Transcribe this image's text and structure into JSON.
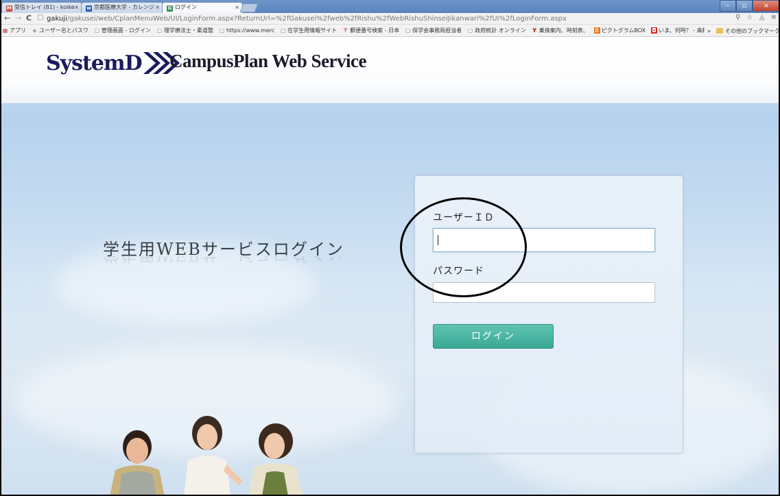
{
  "browser": {
    "tabs": [
      {
        "label": "受信トレイ (81) - koike",
        "favicon": "M",
        "favicon_color": "#d44638"
      },
      {
        "label": "京都医療大学 - カレンジ",
        "favicon": "w",
        "favicon_color": "#2a5db0"
      },
      {
        "label": "ログイン",
        "favicon": "G",
        "favicon_color": "#3b8f5e"
      }
    ],
    "window_buttons": [
      "–",
      "▫",
      "×"
    ],
    "nav": {
      "back": "←",
      "forward": "→",
      "reload": "C"
    },
    "url_host": "gakuji",
    "url_rest": "/gakusei/web/CplanMenuWeb/UI/LoginForm.aspx?ReturnUrl=%2fGakusei%2fweb%2fRishu%2fWebRishuShinseiJikanwari%2fUI%2fLoginForm.aspx",
    "nav_icons": "⚲ ☆ ◬ ≡",
    "bookmarks": [
      {
        "label": "アプリ",
        "icon": "▦"
      },
      {
        "label": "ユーザー名とパスワ",
        "icon": "◈"
      },
      {
        "label": "管理画面 - ログイン",
        "icon": "▢"
      },
      {
        "label": "理学療法士・柔道整",
        "icon": "▢"
      },
      {
        "label": "https://www.merc",
        "icon": "▢"
      },
      {
        "label": "在学生用情報サイト",
        "icon": "▢"
      },
      {
        "label": "郵便番号検索 - 日本",
        "icon": "〒"
      },
      {
        "label": "保学会事務局担当者",
        "icon": "▢"
      },
      {
        "label": "政府統計 オンライン",
        "icon": "▢"
      },
      {
        "label": "乗換案内、時刻表、",
        "icon": "Y"
      },
      {
        "label": "ピクトグラムBOX",
        "icon": "B"
      },
      {
        "label": "いま、何時？ - 高精",
        "icon": "◘"
      }
    ],
    "bookmarks_more": "»",
    "bookmarks_other": "その他のブックマーク"
  },
  "header": {
    "logo_text": "SystemD",
    "service_name": "CampusPlan Web Service"
  },
  "main": {
    "page_title": "学生用WEBサービスログイン"
  },
  "login": {
    "user_id_label": "ユーザーＩＤ",
    "user_id_value": "",
    "password_label": "パスワード",
    "password_value": "",
    "login_button": "ログイン"
  },
  "colors": {
    "button": "#44b09f",
    "logo": "#1a1a5e",
    "sky": "#b6d2ee"
  }
}
